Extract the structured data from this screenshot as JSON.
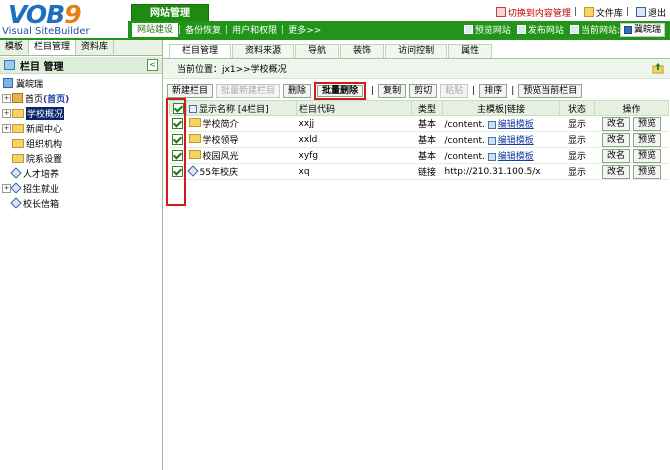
{
  "app": {
    "logo_main": "VOB",
    "logo_nine": "9",
    "logo_sub": "Visual SiteBuilder",
    "main_tab": "网站管理"
  },
  "top_links": {
    "switch_content": "切换到内容管理",
    "file_lib": "文件库",
    "exit": "退出"
  },
  "menubar": {
    "items": [
      "网站建设",
      "备份恢复",
      "用户和权限",
      "更多>>"
    ],
    "preview_site": "预览网站",
    "publish_site": "发布网站",
    "current_site_label": "当前网站:",
    "current_site_value": "冀皖瑞"
  },
  "left": {
    "tabs": [
      "模板",
      "栏目管理",
      "资料库"
    ],
    "active_tab": "栏目管理",
    "title": "栏目 管理",
    "collapse_glyph": "<",
    "tree": {
      "root": "冀皖瑞",
      "home": "首页",
      "home_tag": "(首页)",
      "nodes": [
        "学校概况",
        "新闻中心",
        "组织机构",
        "院系设置",
        "人才培养",
        "招生就业",
        "校长信箱"
      ]
    }
  },
  "right": {
    "tabs": [
      "栏目管理",
      "资料来源",
      "导航",
      "装饰",
      "访问控制",
      "属性"
    ],
    "active_tab": "栏目管理",
    "location_label": "当前位置：",
    "location_value": "jx1>>学校概况",
    "toolbar": {
      "new_column": "新建栏目",
      "batch_new": "批量新建栏目",
      "delete": "删除",
      "batch_delete": "批量删除",
      "copy": "复制",
      "cut": "剪切",
      "paste": "粘贴",
      "sort": "排序",
      "preview_current": "预览当前栏目"
    },
    "table": {
      "headers": {
        "name": "显示名称 [4栏目]",
        "code": "栏目代码",
        "type": "类型",
        "template": "主模板|链接",
        "status": "状态",
        "actions": "操作"
      },
      "rows": [
        {
          "name": "学校简介",
          "code": "xxjj",
          "type": "基本",
          "template": "/content.",
          "edit": "编辑模板",
          "status": "显示",
          "rename": "改名",
          "preview": "预览",
          "icon": "folder"
        },
        {
          "name": "学校领导",
          "code": "xxld",
          "type": "基本",
          "template": "/content.",
          "edit": "编辑模板",
          "status": "显示",
          "rename": "改名",
          "preview": "预览",
          "icon": "folder"
        },
        {
          "name": "校园风光",
          "code": "xyfg",
          "type": "基本",
          "template": "/content.",
          "edit": "编辑模板",
          "status": "显示",
          "rename": "改名",
          "preview": "预览",
          "icon": "folder"
        },
        {
          "name": "55年校庆",
          "code": "xq",
          "type": "链接",
          "template": "http://210.31.100.5/x",
          "edit": "",
          "status": "显示",
          "rename": "改名",
          "preview": "预览",
          "icon": "link"
        }
      ]
    }
  },
  "colors": {
    "brand_green": "#22941a",
    "highlight_red": "#d11a1a",
    "selection_blue": "#0a246a"
  }
}
